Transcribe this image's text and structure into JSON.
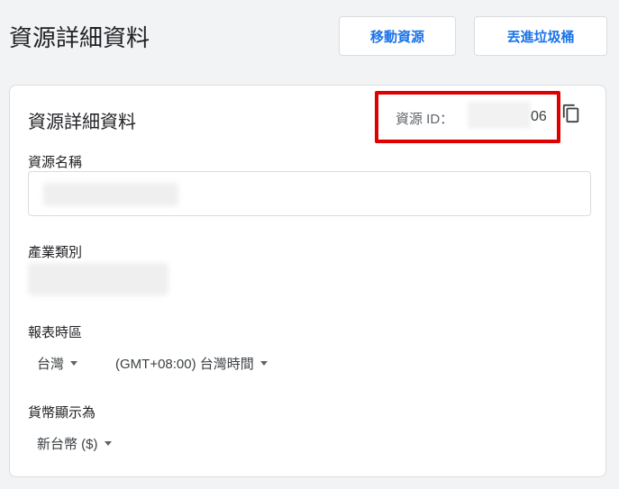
{
  "header": {
    "title": "資源詳細資料",
    "move_button": "移動資源",
    "trash_button": "丟進垃圾桶"
  },
  "card": {
    "title": "資源詳細資料",
    "resource_id_label": "資源 ID：",
    "resource_id_visible_suffix": "06",
    "copy_icon": "copy-icon",
    "highlight_color": "#e00000"
  },
  "fields": {
    "name_label": "資源名稱",
    "industry_label": "產業類別",
    "timezone_label": "報表時區",
    "timezone_country": "台灣",
    "timezone_value": "(GMT+08:00) 台灣時間",
    "currency_label": "貨幣顯示為",
    "currency_value": "新台幣 ($)"
  },
  "colors": {
    "accent": "#1a73e8",
    "background": "#f1f3f4"
  }
}
